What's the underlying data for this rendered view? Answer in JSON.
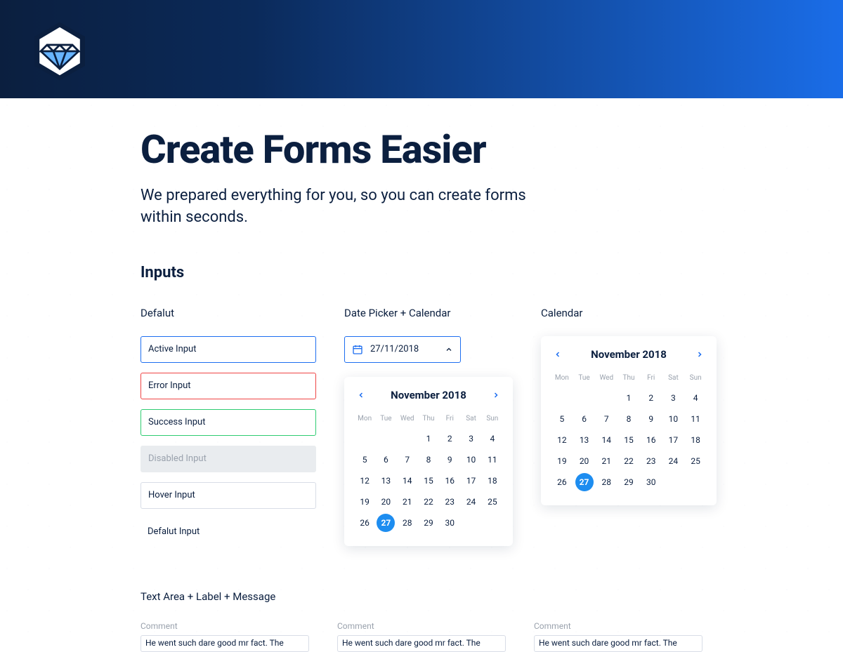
{
  "page": {
    "title": "Create Forms Easier",
    "subtitle": "We prepared everything for you, so you can create forms within seconds."
  },
  "sections": {
    "inputs_heading": "Inputs",
    "default_col_label": "Defalut",
    "datepicker_col_label": "Date Picker + Calendar",
    "calendar_col_label": "Calendar",
    "textarea_col_label": "Text Area + Label + Message"
  },
  "inputs": {
    "active": "Active Input",
    "error": "Error Input",
    "success": "Success Input",
    "disabled": "Disabled Input",
    "hover": "Hover Input",
    "default": "Defalut Input"
  },
  "datepicker": {
    "value": "27/11/2018"
  },
  "calendar": {
    "month_label": "November 2018",
    "dow": [
      "Mon",
      "Tue",
      "Wed",
      "Thu",
      "Fri",
      "Sat",
      "Sun"
    ],
    "lead_blanks": 3,
    "days": 30,
    "selected": 27
  },
  "textarea": {
    "label": "Comment",
    "value": "He went such dare good mr fact. The"
  }
}
